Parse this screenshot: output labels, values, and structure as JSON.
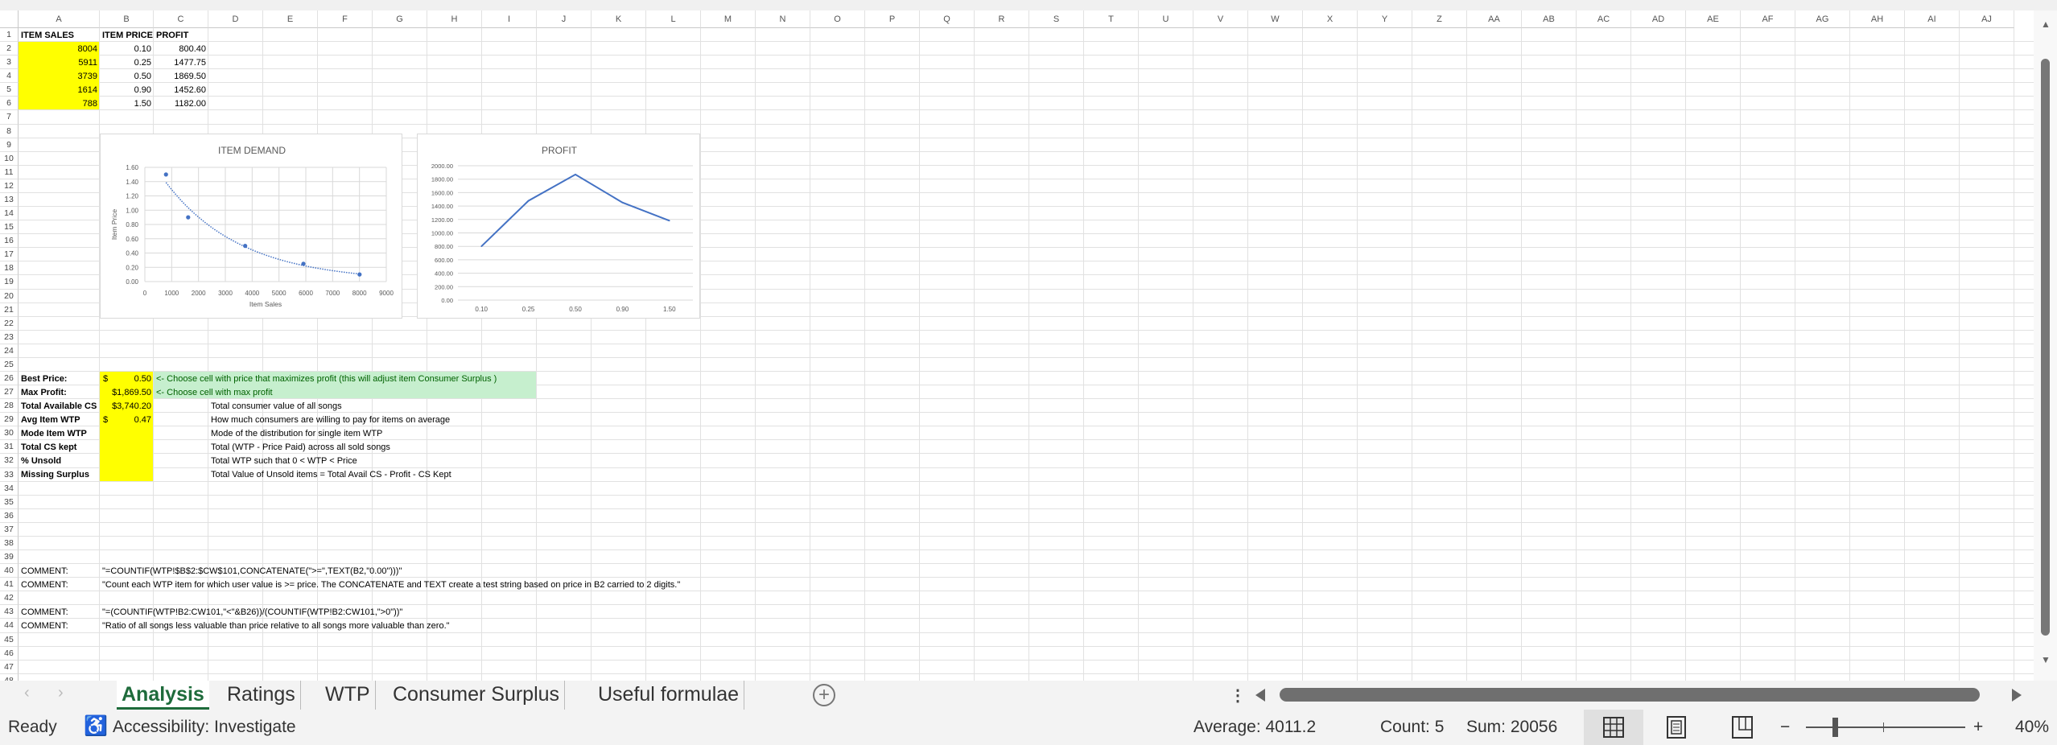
{
  "columns": [
    "A",
    "B",
    "C",
    "D",
    "E",
    "F",
    "G",
    "H",
    "I",
    "J",
    "K",
    "L",
    "M",
    "N",
    "O",
    "P",
    "Q",
    "R",
    "S",
    "T",
    "U",
    "V",
    "W",
    "X",
    "Y",
    "Z",
    "AA",
    "AB",
    "AC",
    "AD",
    "AE",
    "AF",
    "AG",
    "AH",
    "AI",
    "AJ"
  ],
  "row_count": 48,
  "fills": [
    {
      "range": "A2:A6",
      "color": "#FFFF00"
    },
    {
      "range": "B26:B33",
      "color": "#FFFF00"
    },
    {
      "range": "C26:I27",
      "color": "#C6EFCE"
    }
  ],
  "cells": [
    {
      "ref": "A1",
      "value": "ITEM SALES",
      "bold": true
    },
    {
      "ref": "B1",
      "value": "ITEM PRICE",
      "bold": true
    },
    {
      "ref": "C1",
      "value": "PROFIT",
      "bold": true
    },
    {
      "ref": "A2",
      "value": "8004",
      "align": "right"
    },
    {
      "ref": "B2",
      "value": "0.10",
      "align": "right"
    },
    {
      "ref": "C2",
      "value": "800.40",
      "align": "right"
    },
    {
      "ref": "A3",
      "value": "5911",
      "align": "right"
    },
    {
      "ref": "B3",
      "value": "0.25",
      "align": "right"
    },
    {
      "ref": "C3",
      "value": "1477.75",
      "align": "right"
    },
    {
      "ref": "A4",
      "value": "3739",
      "align": "right"
    },
    {
      "ref": "B4",
      "value": "0.50",
      "align": "right"
    },
    {
      "ref": "C4",
      "value": "1869.50",
      "align": "right"
    },
    {
      "ref": "A5",
      "value": "1614",
      "align": "right"
    },
    {
      "ref": "B5",
      "value": "0.90",
      "align": "right"
    },
    {
      "ref": "C5",
      "value": "1452.60",
      "align": "right"
    },
    {
      "ref": "A6",
      "value": "788",
      "align": "right"
    },
    {
      "ref": "B6",
      "value": "1.50",
      "align": "right"
    },
    {
      "ref": "C6",
      "value": "1182.00",
      "align": "right"
    },
    {
      "ref": "A26",
      "value": "Best Price:",
      "bold": true
    },
    {
      "ref": "B26",
      "value": "0.50",
      "currency": "$",
      "align": "right"
    },
    {
      "ref": "C26",
      "value": "<- Choose cell with price that maximizes profit (this will adjust item Consumer Surplus )",
      "green": true
    },
    {
      "ref": "A27",
      "value": "Max Profit:",
      "bold": true
    },
    {
      "ref": "B27",
      "value": "$1,869.50",
      "align": "right"
    },
    {
      "ref": "C27",
      "value": "<- Choose cell with max profit",
      "green": true
    },
    {
      "ref": "A28",
      "value": "Total Available CS",
      "bold": true
    },
    {
      "ref": "B28",
      "value": "$3,740.20",
      "align": "right"
    },
    {
      "ref": "D28",
      "value": "Total consumer value of all songs"
    },
    {
      "ref": "A29",
      "value": "Avg Item WTP",
      "bold": true
    },
    {
      "ref": "B29",
      "value": "0.47",
      "currency": "$",
      "align": "right"
    },
    {
      "ref": "D29",
      "value": "How much consumers are willing to pay for items on average"
    },
    {
      "ref": "A30",
      "value": "Mode Item WTP",
      "bold": true
    },
    {
      "ref": "D30",
      "value": "Mode of the distribution for single item WTP"
    },
    {
      "ref": "A31",
      "value": "Total CS kept",
      "bold": true
    },
    {
      "ref": "D31",
      "value": "Total  (WTP - Price Paid) across all sold songs"
    },
    {
      "ref": "A32",
      "value": "% Unsold",
      "bold": true
    },
    {
      "ref": "D32",
      "value": "Total WTP such that 0 < WTP < Price"
    },
    {
      "ref": "A33",
      "value": "Missing Surplus",
      "bold": true
    },
    {
      "ref": "D33",
      "value": "Total Value of Unsold items = Total Avail CS - Profit - CS Kept"
    },
    {
      "ref": "A40",
      "value": "COMMENT:"
    },
    {
      "ref": "B40",
      "value": "\"=COUNTIF(WTP!$B$2:$CW$101,CONCATENATE(\">=\",TEXT(B2,\"0.00\")))\""
    },
    {
      "ref": "A41",
      "value": "COMMENT:"
    },
    {
      "ref": "B41",
      "value": "\"Count each WTP item for which user value is >= price. The CONCATENATE and TEXT create a test string based on price in B2 carried to 2 digits.\""
    },
    {
      "ref": "A43",
      "value": "COMMENT:"
    },
    {
      "ref": "B43",
      "value": "\"=(COUNTIF(WTP!B2:CW101,\"<\"&B26))/(COUNTIF(WTP!B2:CW101,\">0\"))\""
    },
    {
      "ref": "A44",
      "value": "COMMENT:"
    },
    {
      "ref": "B44",
      "value": "\"Ratio of all songs less valuable than price relative to all songs more valuable than zero.\""
    }
  ],
  "chart_data": [
    {
      "type": "scatter",
      "title": "ITEM DEMAND",
      "xlabel": "Item Sales",
      "ylabel": "Item Price",
      "x": [
        8004,
        5911,
        3739,
        1614,
        788
      ],
      "y": [
        0.1,
        0.25,
        0.5,
        0.9,
        1.5
      ],
      "xlim": [
        0,
        9000
      ],
      "xticks": [
        "0",
        "1000",
        "2000",
        "3000",
        "4000",
        "5000",
        "6000",
        "7000",
        "8000",
        "9000"
      ],
      "ylim": [
        0,
        1.6
      ],
      "yticks": [
        "0.00",
        "0.20",
        "0.40",
        "0.60",
        "0.80",
        "1.00",
        "1.20",
        "1.40",
        "1.60"
      ],
      "trendline": "exponential",
      "grid": true,
      "color": "#4472C4"
    },
    {
      "type": "line",
      "title": "PROFIT",
      "categories": [
        "0.10",
        "0.25",
        "0.50",
        "0.90",
        "1.50"
      ],
      "values": [
        800.4,
        1477.75,
        1869.5,
        1452.6,
        1182.0
      ],
      "ylim": [
        0,
        2000
      ],
      "yticks": [
        "0.00",
        "200.00",
        "400.00",
        "600.00",
        "800.00",
        "1000.00",
        "1200.00",
        "1400.00",
        "1600.00",
        "1800.00",
        "2000.00"
      ],
      "grid": true,
      "color": "#4472C4"
    }
  ],
  "tabs": [
    "Analysis",
    "Ratings",
    "WTP",
    "Consumer Surplus",
    "Useful formulae"
  ],
  "active_tab": "Analysis",
  "status": {
    "ready": "Ready",
    "accessibility": "Accessibility: Investigate",
    "average": "Average: 4011.2",
    "count": "Count: 5",
    "sum": "Sum: 20056",
    "zoom": "40%",
    "zoom_level": 0.4
  }
}
